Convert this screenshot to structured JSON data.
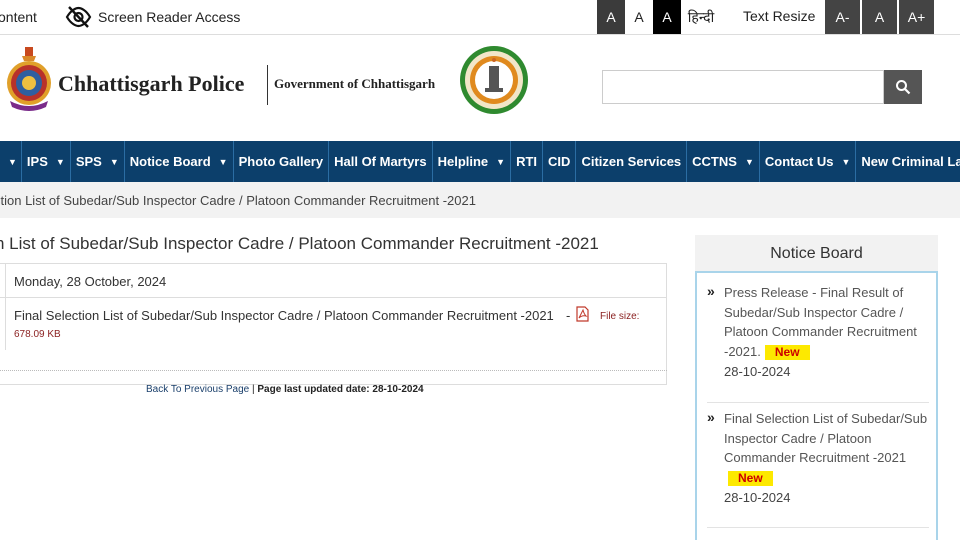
{
  "topbar": {
    "skip_label": "ontent",
    "screen_reader_label": "Screen Reader Access",
    "contrast_buttons": [
      "A",
      "A",
      "A"
    ],
    "hindi_label": "हिन्दी",
    "text_resize_label": "Text Resize",
    "size_buttons": [
      "A-",
      "A",
      "A+"
    ]
  },
  "header": {
    "site_name": "Chhattisgarh Police",
    "gov_name": "Government of Chhattisgarh",
    "search_placeholder": "",
    "icons": {
      "search": "search-icon",
      "eye": "eye-slash-icon"
    }
  },
  "nav": {
    "items": [
      {
        "label": "",
        "caret": true
      },
      {
        "label": "IPS",
        "caret": true
      },
      {
        "label": "SPS",
        "caret": true
      },
      {
        "label": "Notice Board",
        "caret": true
      },
      {
        "label": "Photo Gallery",
        "caret": false
      },
      {
        "label": "Hall Of Martyrs",
        "caret": false
      },
      {
        "label": "Helpline",
        "caret": true
      },
      {
        "label": "RTI",
        "caret": false
      },
      {
        "label": "CID",
        "caret": false
      },
      {
        "label": "Citizen Services",
        "caret": false
      },
      {
        "label": "CCTNS",
        "caret": true
      },
      {
        "label": "Contact Us",
        "caret": true
      },
      {
        "label": "New Criminal Laws",
        "caret": true
      }
    ]
  },
  "breadcrumb": {
    "current": "ction List of Subedar/Sub Inspector Cadre / Platoon Commander Recruitment -2021"
  },
  "main": {
    "title": "n List of Subedar/Sub Inspector Cadre / Platoon Commander Recruitment -2021",
    "date": "Monday, 28 October, 2024",
    "file_link": "Final Selection List of Subedar/Sub Inspector Cadre / Platoon Commander Recruitment -2021",
    "file_dash": "-",
    "file_size_label": "File size:",
    "file_size_value": "678.09 KB",
    "back_link": "Back To Previous Page",
    "separator": "|",
    "last_updated": "Page last updated date: 28-10-2024"
  },
  "notice_board": {
    "title": "Notice Board",
    "items": [
      {
        "text": "Press Release - Final Result of Subedar/Sub Inspector Cadre / Platoon Commander Recruitment -2021.",
        "badge": "New",
        "date": "28-10-2024"
      },
      {
        "text": "Final Selection List of Subedar/Sub Inspector Cadre / Platoon Commander Recruitment -2021",
        "badge": "New",
        "date": "28-10-2024"
      }
    ]
  },
  "colors": {
    "nav_bg": "#0c3f6b",
    "new_badge_bg": "#fde900",
    "new_badge_text": "#cc0000",
    "notice_border": "#a9d4ea"
  }
}
